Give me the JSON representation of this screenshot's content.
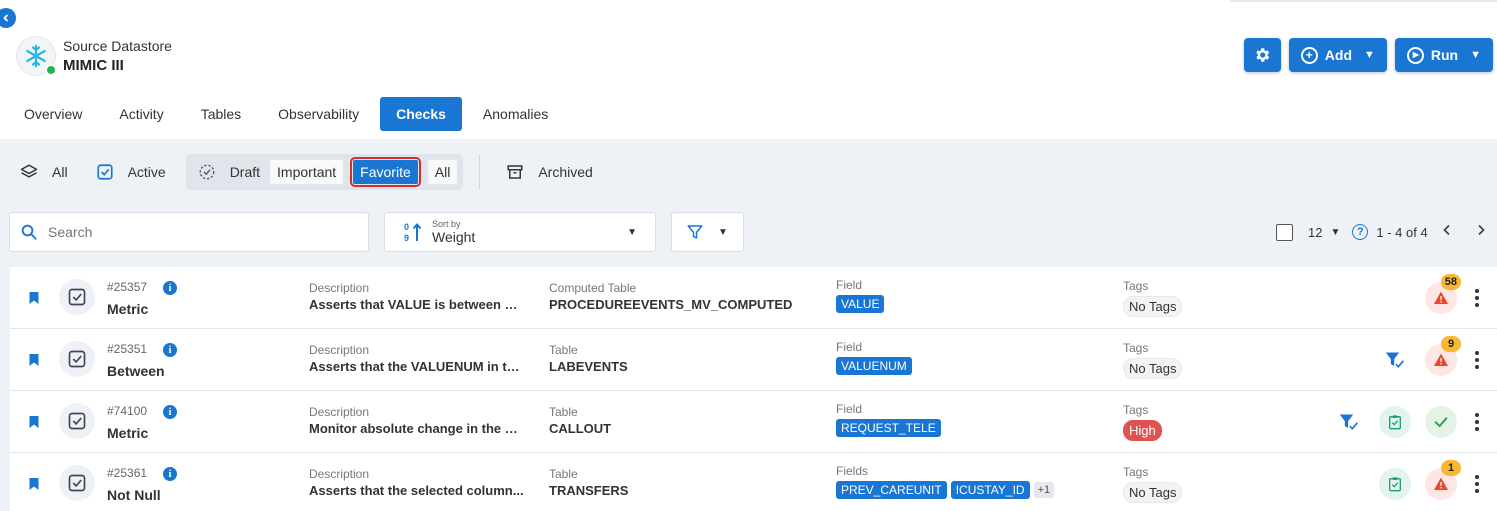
{
  "header": {
    "subtitle": "Source Datastore",
    "title": "MIMIC III"
  },
  "actions": {
    "add_label": "Add",
    "run_label": "Run"
  },
  "tabs": [
    {
      "label": "Overview"
    },
    {
      "label": "Activity"
    },
    {
      "label": "Tables"
    },
    {
      "label": "Observability"
    },
    {
      "label": "Checks",
      "active": true
    },
    {
      "label": "Anomalies"
    }
  ],
  "status_filters": {
    "all": "All",
    "active": "Active",
    "draft": "Draft",
    "important": "Important",
    "favorite": "Favorite",
    "draft_all": "All",
    "archived": "Archived"
  },
  "search": {
    "placeholder": "Search"
  },
  "sort": {
    "label": "Sort by",
    "value": "Weight"
  },
  "pagination": {
    "per_page": "12",
    "range": "1 - 4 of 4"
  },
  "colors": {
    "accent": "#1976d2",
    "high": "#e05252",
    "selected_outline": "#d32f2f"
  },
  "checks": [
    {
      "id": "#25357",
      "type": "Metric",
      "desc_label": "Description",
      "description": "Asserts that VALUE is between MI...",
      "table_label": "Computed Table",
      "table": "PROCEDUREEVENTS_MV_COMPUTED",
      "field_label": "Field",
      "fields": [
        "VALUE"
      ],
      "more": "",
      "tags_label": "Tags",
      "tag": "No Tags",
      "anomaly_count": "58"
    },
    {
      "id": "#25351",
      "type": "Between",
      "desc_label": "Description",
      "description": "Asserts that the VALUENUM in th...",
      "table_label": "Table",
      "table": "LABEVENTS",
      "field_label": "Field",
      "fields": [
        "VALUENUM"
      ],
      "more": "",
      "tags_label": "Tags",
      "tag": "No Tags",
      "anomaly_count": "9"
    },
    {
      "id": "#74100",
      "type": "Metric",
      "desc_label": "Description",
      "description": "Monitor absolute change in the m...",
      "table_label": "Table",
      "table": "CALLOUT",
      "field_label": "Field",
      "fields": [
        "REQUEST_TELE"
      ],
      "more": "",
      "tags_label": "Tags",
      "tag": "High",
      "anomaly_count": ""
    },
    {
      "id": "#25361",
      "type": "Not Null",
      "desc_label": "Description",
      "description": "Asserts that the selected column...",
      "table_label": "Table",
      "table": "TRANSFERS",
      "field_label": "Fields",
      "fields": [
        "PREV_CAREUNIT",
        "ICUSTAY_ID"
      ],
      "more": "+1",
      "tags_label": "Tags",
      "tag": "No Tags",
      "anomaly_count": "1"
    }
  ]
}
